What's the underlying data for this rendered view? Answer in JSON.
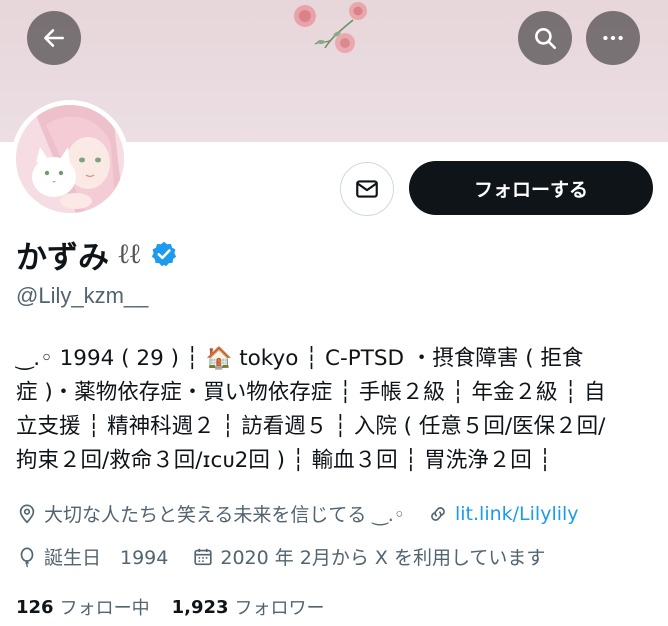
{
  "header": {
    "back_icon": "arrow-left-icon",
    "search_icon": "search-icon",
    "more_icon": "more-horizontal-icon"
  },
  "profile": {
    "display_name": "かずみ",
    "name_decoration": "ℓℓ",
    "verified_icon": "verified-badge-icon",
    "handle": "@Lily_kzm__",
    "message_icon": "mail-icon",
    "follow_label": "フォローする",
    "bio_lines": [
      "‿.◦ 1994 ( 29 ) ┆ 🏠 tokyo ┆ C-PTSD ・摂食障害 ( 拒食",
      "症 )・薬物依存症・買い物依存症 ┆ 手帳２級 ┆ 年金２級 ┆ 自",
      "立支援 ┆ 精神科週２ ┆ 訪看週５ ┆ 入院 ( 任意５回/医保２回/",
      "拘束２回/救命３回/ɪᴄᴜ2回 ) ┆ 輸血３回 ┆ 胃洗浄２回 ┆"
    ],
    "location": "大切な人たちと笑える未来を信じてる ‿.◦",
    "link": "lit.link/Lilylily",
    "birthday": "誕生日　1994",
    "joined": "2020 年 2月から X を利用しています",
    "following_count": "126",
    "following_label": "フォロー中",
    "followers_count": "1,923",
    "followers_label": "フォロワー"
  },
  "colors": {
    "accent": "#1d9bf0",
    "text_primary": "#0f1419",
    "text_secondary": "#536471",
    "banner": "#e7d6da",
    "follow_button": "#0f1419"
  }
}
